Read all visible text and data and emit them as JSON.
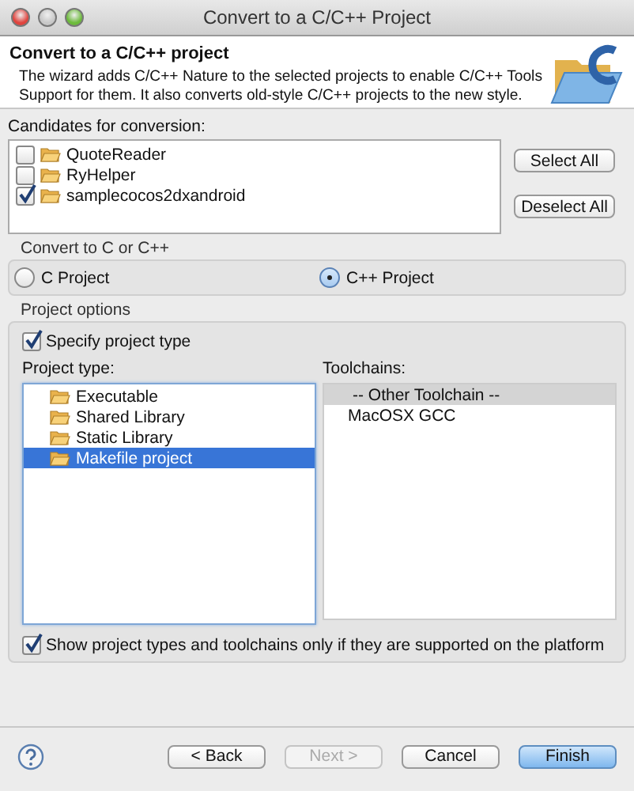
{
  "window": {
    "title": "Convert to a C/C++ Project"
  },
  "header": {
    "title": "Convert to a C/C++ project",
    "description": "The wizard adds C/C++ Nature to the selected projects to enable C/C++ Tools Support for them. It also converts old-style C/C++ projects to the new style."
  },
  "candidates": {
    "label": "Candidates for conversion:",
    "items": [
      {
        "label": "QuoteReader",
        "checked": false
      },
      {
        "label": "RyHelper",
        "checked": false
      },
      {
        "label": "samplecocos2dxandroid",
        "checked": true
      }
    ],
    "buttons": [
      "Select All",
      "Deselect All"
    ]
  },
  "convert": {
    "label": "Convert to C or C++",
    "options": [
      {
        "label": "C Project",
        "selected": false
      },
      {
        "label": "C++ Project",
        "selected": true
      }
    ]
  },
  "project_options": {
    "label": "Project options",
    "specify": {
      "label": "Specify project type",
      "checked": true
    },
    "project_type": {
      "label": "Project type:",
      "items": [
        {
          "label": "Executable",
          "selected": false
        },
        {
          "label": "Shared Library",
          "selected": false
        },
        {
          "label": "Static Library",
          "selected": false
        },
        {
          "label": "Makefile project",
          "selected": true
        }
      ]
    },
    "toolchains": {
      "label": "Toolchains:",
      "items": [
        {
          "label": "-- Other Toolchain --",
          "selected": true
        },
        {
          "label": "MacOSX GCC",
          "selected": false
        }
      ]
    },
    "show_supported": {
      "label": "Show project types and toolchains only if they are supported on the platform",
      "checked": true
    }
  },
  "footer": {
    "buttons": [
      {
        "label": "< Back",
        "disabled": false,
        "default": false
      },
      {
        "label": "Next >",
        "disabled": true,
        "default": false
      },
      {
        "label": "Cancel",
        "disabled": false,
        "default": false
      },
      {
        "label": "Finish",
        "disabled": false,
        "default": true
      }
    ]
  }
}
